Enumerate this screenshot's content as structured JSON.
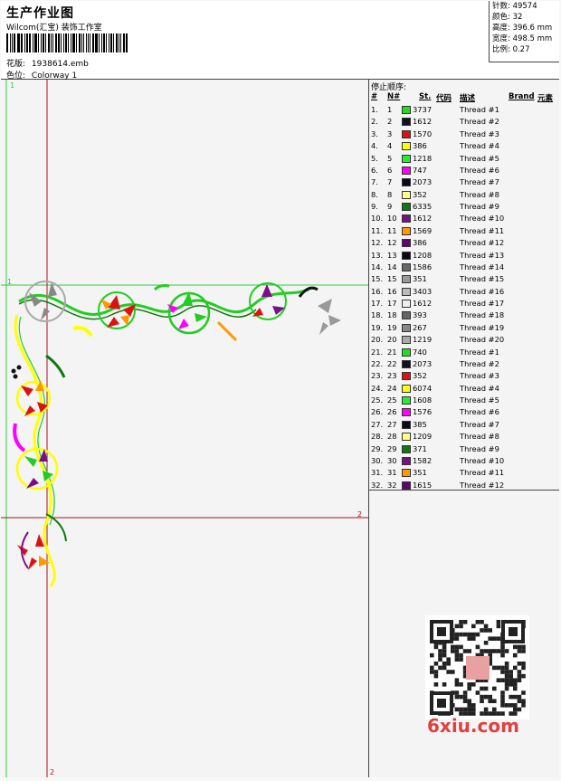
{
  "header": {
    "title": "生产作业图",
    "studio": "Wilcom(汇宝) 装饰工作室",
    "design_label": "花版:",
    "design_value": "1938614.emb",
    "colorway_label": "色位:",
    "colorway_value": "Colorway 1"
  },
  "stats": {
    "stitches": "针数: 49574",
    "colors": "颜色: 32",
    "height": "高度: 396.6 mm",
    "width": "宽度: 498.5 mm",
    "scale": "比例: 0.27"
  },
  "canvas": {
    "marker_top_left": "1",
    "marker_left": "1",
    "marker_right": "2",
    "marker_bottom": "2"
  },
  "sequence": {
    "title": "停止顺序:",
    "headers": {
      "num": "#",
      "needle": "N#",
      "stitches": "St.",
      "code": "代码",
      "desc": "描述",
      "brand": "Brand",
      "element": "元素"
    },
    "rows": [
      {
        "num": "1.",
        "needle": "1",
        "color": "#22dd22",
        "st": "3737",
        "desc": "Thread #1"
      },
      {
        "num": "2.",
        "needle": "2",
        "color": "#111122",
        "st": "1612",
        "desc": "Thread #2"
      },
      {
        "num": "3.",
        "needle": "3",
        "color": "#dd1111",
        "st": "1570",
        "desc": "Thread #3"
      },
      {
        "num": "4.",
        "needle": "4",
        "color": "#ffff00",
        "st": "386",
        "desc": "Thread #4"
      },
      {
        "num": "5.",
        "needle": "5",
        "color": "#22ee33",
        "st": "1218",
        "desc": "Thread #5"
      },
      {
        "num": "6.",
        "needle": "6",
        "color": "#ff00ff",
        "st": "747",
        "desc": "Thread #6"
      },
      {
        "num": "7.",
        "needle": "7",
        "color": "#0a0a14",
        "st": "2073",
        "desc": "Thread #7"
      },
      {
        "num": "8.",
        "needle": "8",
        "color": "#ffff88",
        "st": "352",
        "desc": "Thread #8"
      },
      {
        "num": "9.",
        "needle": "9",
        "color": "#117711",
        "st": "6335",
        "desc": "Thread #9"
      },
      {
        "num": "10.",
        "needle": "10",
        "color": "#771188",
        "st": "1612",
        "desc": "Thread #10"
      },
      {
        "num": "11.",
        "needle": "11",
        "color": "#ff9900",
        "st": "1569",
        "desc": "Thread #11"
      },
      {
        "num": "12.",
        "needle": "12",
        "color": "#660077",
        "st": "386",
        "desc": "Thread #12"
      },
      {
        "num": "13.",
        "needle": "13",
        "color": "#0a0a14",
        "st": "1208",
        "desc": "Thread #13"
      },
      {
        "num": "14.",
        "needle": "14",
        "color": "#666666",
        "st": "1586",
        "desc": "Thread #14"
      },
      {
        "num": "15.",
        "needle": "15",
        "color": "#999999",
        "st": "351",
        "desc": "Thread #15"
      },
      {
        "num": "16.",
        "needle": "16",
        "color": "#bbbbbb",
        "st": "3403",
        "desc": "Thread #16"
      },
      {
        "num": "17.",
        "needle": "17",
        "color": "#eeeeee",
        "st": "1612",
        "desc": "Thread #17"
      },
      {
        "num": "18.",
        "needle": "18",
        "color": "#666666",
        "st": "393",
        "desc": "Thread #18"
      },
      {
        "num": "19.",
        "needle": "19",
        "color": "#888888",
        "st": "267",
        "desc": "Thread #19"
      },
      {
        "num": "20.",
        "needle": "20",
        "color": "#aaaaaa",
        "st": "1219",
        "desc": "Thread #20"
      },
      {
        "num": "21.",
        "needle": "21",
        "color": "#22dd22",
        "st": "740",
        "desc": "Thread #1"
      },
      {
        "num": "22.",
        "needle": "22",
        "color": "#111122",
        "st": "2073",
        "desc": "Thread #2"
      },
      {
        "num": "23.",
        "needle": "23",
        "color": "#dd1111",
        "st": "352",
        "desc": "Thread #3"
      },
      {
        "num": "24.",
        "needle": "24",
        "color": "#ffff00",
        "st": "6074",
        "desc": "Thread #4"
      },
      {
        "num": "25.",
        "needle": "25",
        "color": "#22ee33",
        "st": "1608",
        "desc": "Thread #5"
      },
      {
        "num": "26.",
        "needle": "26",
        "color": "#ff00ff",
        "st": "1576",
        "desc": "Thread #6"
      },
      {
        "num": "27.",
        "needle": "27",
        "color": "#0a0a14",
        "st": "385",
        "desc": "Thread #7"
      },
      {
        "num": "28.",
        "needle": "28",
        "color": "#ffff88",
        "st": "1209",
        "desc": "Thread #8"
      },
      {
        "num": "29.",
        "needle": "29",
        "color": "#117711",
        "st": "371",
        "desc": "Thread #9"
      },
      {
        "num": "30.",
        "needle": "30",
        "color": "#771188",
        "st": "1582",
        "desc": "Thread #10"
      },
      {
        "num": "31.",
        "needle": "31",
        "color": "#ff9900",
        "st": "351",
        "desc": "Thread #11"
      },
      {
        "num": "32.",
        "needle": "32",
        "color": "#660077",
        "st": "1615",
        "desc": "Thread #12"
      }
    ]
  },
  "watermark": {
    "site": "6xiu.com"
  }
}
